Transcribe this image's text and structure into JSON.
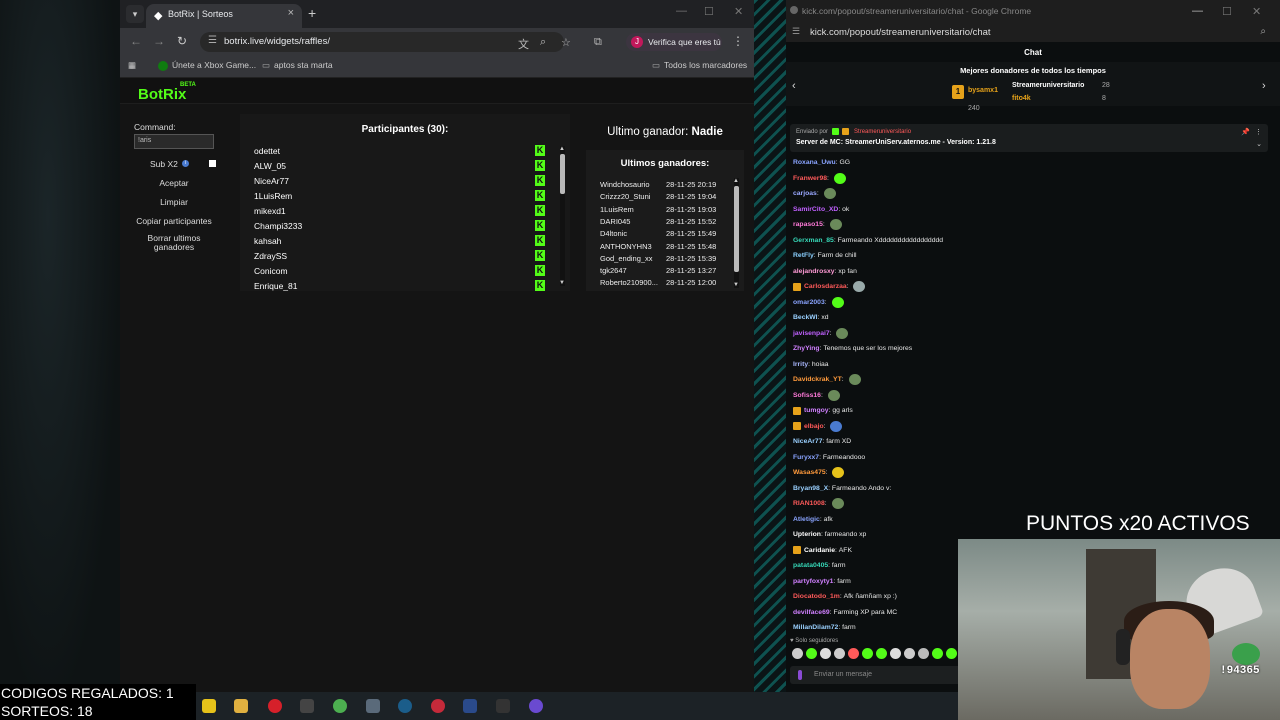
{
  "left_window": {
    "tab_title": "BotRix | Sorteos",
    "url": "botrix.live/widgets/raffles/",
    "profile_label": "Verifica que eres tú",
    "bookmarks": [
      "Únete a Xbox Game...",
      "aptos sta marta"
    ],
    "all_bookmarks": "Todos los marcadores"
  },
  "botrix": {
    "logo": "BotRix",
    "beta": "BETA",
    "command_label": "Command:",
    "command_value": "!aris",
    "sub_label": "Sub X2",
    "sub_checked": true,
    "buttons": [
      "Aceptar",
      "Limpiar",
      "Copiar participantes",
      "Borrar ultimos ganadores"
    ],
    "participants_title": "Participantes (30):",
    "participants": [
      "odettet",
      "ALW_05",
      "NiceAr77",
      "1LuisRem",
      "mikexd1",
      "Champi3233",
      "kahsah",
      "ZdraySS",
      "Conicom",
      "Enrique_81"
    ],
    "last_winner_label": "Ultimo ganador:",
    "last_winner_name": "Nadie",
    "winners_title": "Ultimos ganadores:",
    "winners": [
      {
        "name": "Windchosaurio",
        "date": "28-11-25 20:19"
      },
      {
        "name": "Crizzz20_Stuni",
        "date": "28-11-25 19:04"
      },
      {
        "name": "1LuisRem",
        "date": "28-11-25 19:03"
      },
      {
        "name": "DARI045",
        "date": "28-11-25 15:52"
      },
      {
        "name": "D4ltonic",
        "date": "28-11-25 15:49"
      },
      {
        "name": "ANTHONYHN3",
        "date": "28-11-25 15:48"
      },
      {
        "name": "God_ending_xx",
        "date": "28-11-25 15:39"
      },
      {
        "name": "tgk2647",
        "date": "28-11-25 13:27"
      },
      {
        "name": "Roberto210900...",
        "date": "28-11-25 12:00"
      }
    ]
  },
  "right_window": {
    "title": "kick.com/popout/streameruniversitario/chat - Google Chrome",
    "url": "kick.com/popout/streameruniversitario/chat",
    "chat_header": "Chat",
    "donors_title": "Mejores donadores de todos los tiempos",
    "donors": [
      {
        "name": "bysamx1",
        "amount": "240",
        "color": "#e6a21a"
      },
      {
        "name": "Streameruniversitario",
        "amount": "28",
        "color": "#ffffff"
      },
      {
        "name": "fito4k",
        "amount": "8",
        "color": "#e6a21a"
      }
    ],
    "pinned_by": "Enviado por",
    "pinned_user": "Streameruniversitario",
    "pinned_message": "Server de MC: StreamerUniServ.aternos.me - Version: 1.21.8",
    "messages": [
      {
        "user": "Roxana_Uwu",
        "text": "GG",
        "color": "#8aa4ff",
        "badge": false,
        "emote": ""
      },
      {
        "user": "Franwer98",
        "text": "",
        "color": "#ff5a5a",
        "badge": false,
        "emote": "#53fc18"
      },
      {
        "user": "carjoas",
        "text": "",
        "color": "#9aa8ff",
        "badge": false,
        "emote": "#6a8a5a"
      },
      {
        "user": "SamirCito_XD",
        "text": "ok",
        "color": "#c060ff",
        "badge": false,
        "emote": ""
      },
      {
        "user": "rapaso15",
        "text": "",
        "color": "#ff7ad9",
        "badge": false,
        "emote": "#6a8a5a"
      },
      {
        "user": "Gerxman_85",
        "text": "Farmeando Xddddddddddddddddd",
        "color": "#36d7b7",
        "badge": false,
        "emote": ""
      },
      {
        "user": "RetFly",
        "text": "Farm de chill",
        "color": "#8ad0ff",
        "badge": false,
        "emote": ""
      },
      {
        "user": "alejandrosxy",
        "text": "xp fan",
        "color": "#ff9ad5",
        "badge": false,
        "emote": ""
      },
      {
        "user": "Carlosdarzaa",
        "text": "",
        "color": "#ff5a5a",
        "badge": true,
        "emote": "#9aa"
      },
      {
        "user": "omar2003",
        "text": "",
        "color": "#8aa4ff",
        "badge": false,
        "emote": "#53fc18"
      },
      {
        "user": "BeckWl",
        "text": "xd",
        "color": "#9ad0ff",
        "badge": false,
        "emote": ""
      },
      {
        "user": "javisenpai7",
        "text": "",
        "color": "#c060ff",
        "badge": false,
        "emote": "#6a8a5a"
      },
      {
        "user": "ZhyYing",
        "text": "Tenemos que ser los mejores",
        "color": "#d080ff",
        "badge": false,
        "emote": ""
      },
      {
        "user": "Irrity",
        "text": "hoiaa",
        "color": "#aab8ff",
        "badge": false,
        "emote": ""
      },
      {
        "user": "Davidckrak_YT",
        "text": "",
        "color": "#ff9a3c",
        "badge": false,
        "emote": "#6a8a5a"
      },
      {
        "user": "Sofiss16",
        "text": "",
        "color": "#ff7ad9",
        "badge": false,
        "emote": "#6a8a5a"
      },
      {
        "user": "tumgoy",
        "text": "gg arls",
        "color": "#d080ff",
        "badge": true,
        "emote": ""
      },
      {
        "user": "elbajo",
        "text": "",
        "color": "#ff5a5a",
        "badge": true,
        "emote": "#4a7bd0"
      },
      {
        "user": "NiceAr77",
        "text": "farm XD",
        "color": "#9ad0ff",
        "badge": false,
        "emote": ""
      },
      {
        "user": "Furyxx7",
        "text": "Farmeandooo",
        "color": "#8aa4ff",
        "badge": false,
        "emote": ""
      },
      {
        "user": "Wasas475",
        "text": "",
        "color": "#ff9a3c",
        "badge": false,
        "emote": "#e6c21a"
      },
      {
        "user": "Bryan98_X",
        "text": "Farmeando Ando v:",
        "color": "#9ad0ff",
        "badge": false,
        "emote": ""
      },
      {
        "user": "RIAN1008",
        "text": "",
        "color": "#ff5a5a",
        "badge": false,
        "emote": "#6a8a5a"
      },
      {
        "user": "Atletigic",
        "text": "afk",
        "color": "#8aa4ff",
        "badge": false,
        "emote": ""
      },
      {
        "user": "Upterion",
        "text": "farmeando xp",
        "color": "#ffffff",
        "badge": false,
        "emote": ""
      },
      {
        "user": "Caridanie",
        "text": "AFK",
        "color": "#ffffff",
        "badge": true,
        "emote": ""
      },
      {
        "user": "patata0405",
        "text": "farm",
        "color": "#36d7b7",
        "badge": false,
        "emote": ""
      },
      {
        "user": "partyfoxyty1",
        "text": "farm",
        "color": "#d080ff",
        "badge": false,
        "emote": ""
      },
      {
        "user": "Diocatodo_1m",
        "text": "Afk ñamñam xp :)",
        "color": "#ff5a5a",
        "badge": false,
        "emote": ""
      },
      {
        "user": "devilface69",
        "text": "Farming XP para MC",
        "color": "#d080ff",
        "badge": false,
        "emote": ""
      },
      {
        "user": "MillanDilam72",
        "text": "farm",
        "color": "#9ad0ff",
        "badge": false,
        "emote": ""
      }
    ],
    "followers_only": "Solo seguidores",
    "input_placeholder": "Enviar un mensaje"
  },
  "overlay": {
    "puntos": "PUNTOS x20 ACTIVOS",
    "codes_line": "CODIGOS REGALADOS: 1",
    "sorteos_line": "SORTEOS: 18",
    "counter": "!94365"
  }
}
